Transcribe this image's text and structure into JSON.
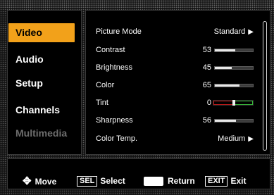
{
  "sidebar": {
    "items": [
      {
        "label": "Video",
        "state": "selected"
      },
      {
        "label": "Audio",
        "state": "normal"
      },
      {
        "label": "Setup",
        "state": "normal"
      },
      {
        "label": "Channels",
        "state": "normal"
      },
      {
        "label": "Multimedia",
        "state": "disabled"
      }
    ]
  },
  "settings": {
    "picture_mode": {
      "label": "Picture Mode",
      "value": "Standard",
      "arrow": "▶"
    },
    "contrast": {
      "label": "Contrast",
      "value": "53",
      "level": 0.53
    },
    "brightness": {
      "label": "Brightness",
      "value": "45",
      "level": 0.45
    },
    "color": {
      "label": "Color",
      "value": "65",
      "level": 0.65
    },
    "tint": {
      "label": "Tint",
      "value": "0",
      "level": 0.5
    },
    "sharpness": {
      "label": "Sharpness",
      "value": "56",
      "level": 0.56
    },
    "color_temp": {
      "label": "Color Temp.",
      "value": "Medium",
      "arrow": "▶"
    }
  },
  "footer": {
    "move_label": "Move",
    "move_icon": "✥",
    "sel_key": "SEL",
    "select_label": "Select",
    "return_label": "Return",
    "exit_key": "EXIT",
    "exit_label": "Exit"
  },
  "colors": {
    "accent": "#f2a11a",
    "tint_red": "#c01a1a",
    "tint_green": "#38b83a"
  }
}
